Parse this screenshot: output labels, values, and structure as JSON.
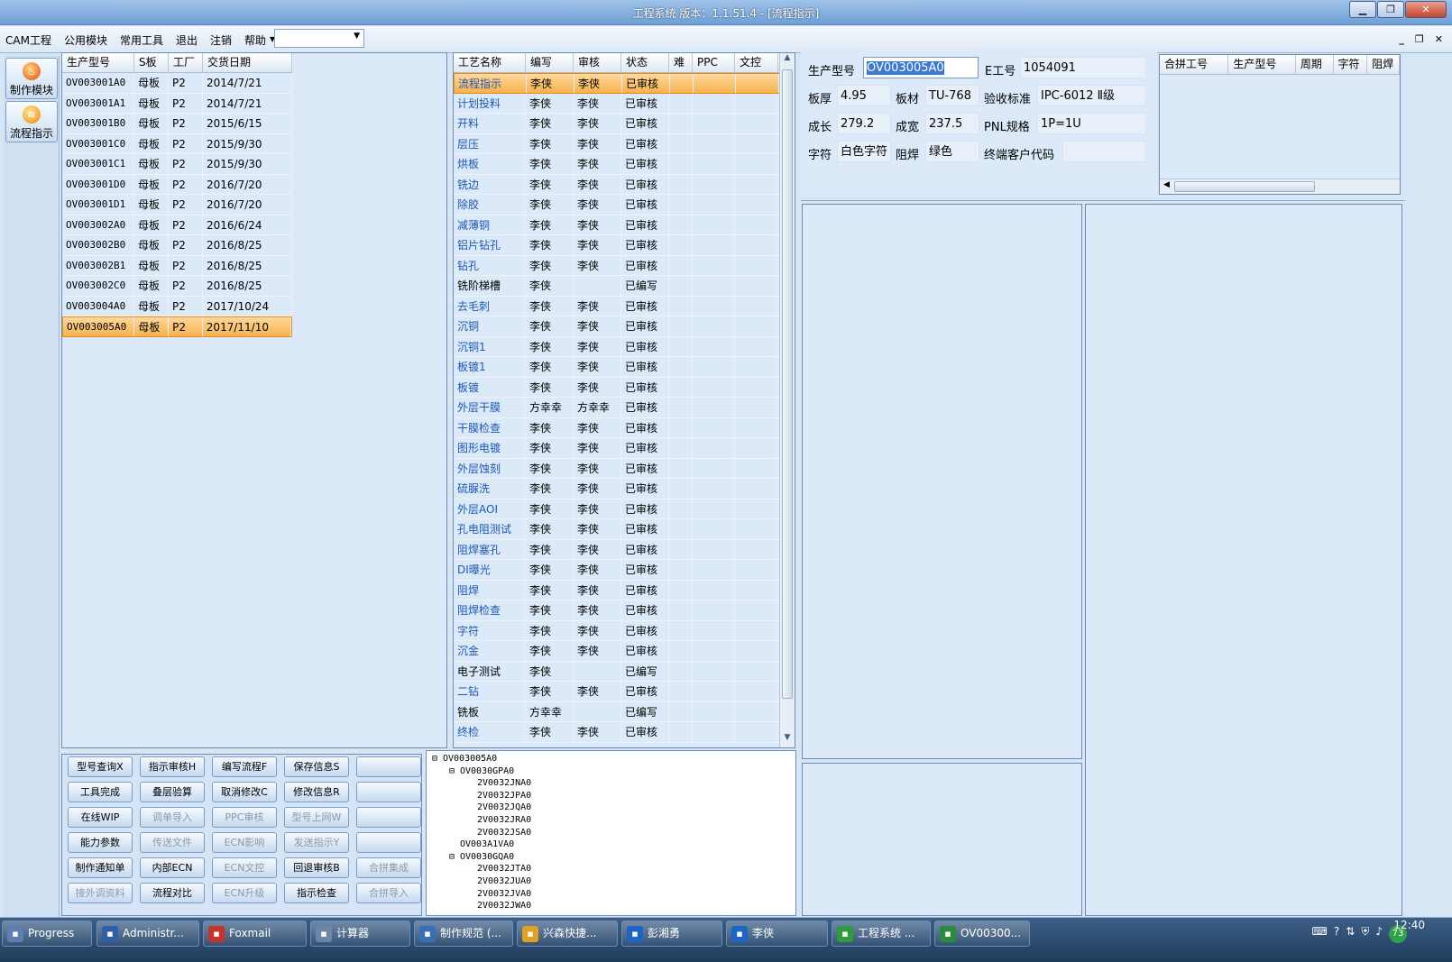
{
  "window": {
    "title": "工程系统    版本：1.1.51.4 - [流程指示]"
  },
  "menu": [
    "CAM工程",
    "公用模块",
    "常用工具",
    "退出",
    "注销",
    "帮助"
  ],
  "menu_help_arrow": "▾",
  "leftbar": [
    {
      "label": "制作模块",
      "icon": "fire-icon"
    },
    {
      "label": "流程指示",
      "icon": "flow-icon"
    }
  ],
  "products": {
    "headers": [
      "生产型号",
      "S板",
      "工厂",
      "交货日期"
    ],
    "rows": [
      [
        "OV003001A0",
        "母板",
        "P2",
        "2014/7/21"
      ],
      [
        "OV003001A1",
        "母板",
        "P2",
        "2014/7/21"
      ],
      [
        "OV003001B0",
        "母板",
        "P2",
        "2015/6/15"
      ],
      [
        "OV003001C0",
        "母板",
        "P2",
        "2015/9/30"
      ],
      [
        "OV003001C1",
        "母板",
        "P2",
        "2015/9/30"
      ],
      [
        "OV003001D0",
        "母板",
        "P2",
        "2016/7/20"
      ],
      [
        "OV003001D1",
        "母板",
        "P2",
        "2016/7/20"
      ],
      [
        "OV003002A0",
        "母板",
        "P2",
        "2016/6/24"
      ],
      [
        "OV003002B0",
        "母板",
        "P2",
        "2016/8/25"
      ],
      [
        "OV003002B1",
        "母板",
        "P2",
        "2016/8/25"
      ],
      [
        "OV003002C0",
        "母板",
        "P2",
        "2016/8/25"
      ],
      [
        "OV003004A0",
        "母板",
        "P2",
        "2017/10/24"
      ],
      [
        "OV003005A0",
        "母板",
        "P2",
        "2017/11/10"
      ]
    ],
    "selected": 12
  },
  "processes": {
    "headers": [
      "工艺名称",
      "编写",
      "审核",
      "状态",
      "难",
      "PPC",
      "文控"
    ],
    "rows": [
      [
        "流程指示",
        "李侠",
        "李侠",
        "已审核"
      ],
      [
        "计划投料",
        "李侠",
        "李侠",
        "已审核"
      ],
      [
        "开料",
        "李侠",
        "李侠",
        "已审核"
      ],
      [
        "层压",
        "李侠",
        "李侠",
        "已审核"
      ],
      [
        "烘板",
        "李侠",
        "李侠",
        "已审核"
      ],
      [
        "铣边",
        "李侠",
        "李侠",
        "已审核"
      ],
      [
        "除胶",
        "李侠",
        "李侠",
        "已审核"
      ],
      [
        "减薄铜",
        "李侠",
        "李侠",
        "已审核"
      ],
      [
        "铝片钻孔",
        "李侠",
        "李侠",
        "已审核"
      ],
      [
        "钻孔",
        "李侠",
        "李侠",
        "已审核"
      ],
      [
        "铣阶梯槽",
        "李侠",
        "",
        "已编写"
      ],
      [
        "去毛刺",
        "李侠",
        "李侠",
        "已审核"
      ],
      [
        "沉铜",
        "李侠",
        "李侠",
        "已审核"
      ],
      [
        "沉铜1",
        "李侠",
        "李侠",
        "已审核"
      ],
      [
        "板镀1",
        "李侠",
        "李侠",
        "已审核"
      ],
      [
        "板镀",
        "李侠",
        "李侠",
        "已审核"
      ],
      [
        "外层干膜",
        "方幸幸",
        "方幸幸",
        "已审核"
      ],
      [
        "干膜检查",
        "李侠",
        "李侠",
        "已审核"
      ],
      [
        "图形电镀",
        "李侠",
        "李侠",
        "已审核"
      ],
      [
        "外层蚀刻",
        "李侠",
        "李侠",
        "已审核"
      ],
      [
        "硫脲洗",
        "李侠",
        "李侠",
        "已审核"
      ],
      [
        "外层AOI",
        "李侠",
        "李侠",
        "已审核"
      ],
      [
        "孔电阻测试",
        "李侠",
        "李侠",
        "已审核"
      ],
      [
        "阻焊塞孔",
        "李侠",
        "李侠",
        "已审核"
      ],
      [
        "DI曝光",
        "李侠",
        "李侠",
        "已审核"
      ],
      [
        "阻焊",
        "李侠",
        "李侠",
        "已审核"
      ],
      [
        "阻焊检查",
        "李侠",
        "李侠",
        "已审核"
      ],
      [
        "字符",
        "李侠",
        "李侠",
        "已审核"
      ],
      [
        "沉金",
        "李侠",
        "李侠",
        "已审核"
      ],
      [
        "电子测试",
        "李侠",
        "",
        "已编写"
      ],
      [
        "二钻",
        "李侠",
        "李侠",
        "已审核"
      ],
      [
        "铣板",
        "方幸幸",
        "",
        "已编写"
      ],
      [
        "终检",
        "李侠",
        "李侠",
        "已审核"
      ]
    ],
    "selected": 0
  },
  "buttons": [
    [
      {
        "t": "型号查询X",
        "d": false
      },
      {
        "t": "指示审核H",
        "d": false
      },
      {
        "t": "编写流程F",
        "d": false
      },
      {
        "t": "保存信息S",
        "d": false
      },
      {
        "t": "",
        "d": false
      }
    ],
    [
      {
        "t": "工具完成",
        "d": false
      },
      {
        "t": "叠层验算",
        "d": false
      },
      {
        "t": "取消修改C",
        "d": false
      },
      {
        "t": "修改信息R",
        "d": false
      },
      {
        "t": "",
        "d": false
      }
    ],
    [
      {
        "t": "在线WIP",
        "d": false
      },
      {
        "t": "调单导入",
        "d": true
      },
      {
        "t": "PPC审核",
        "d": true
      },
      {
        "t": "型号上网W",
        "d": true
      },
      {
        "t": "",
        "d": false
      }
    ],
    [
      {
        "t": "能力参数",
        "d": false
      },
      {
        "t": "传送文件",
        "d": true
      },
      {
        "t": "ECN影响",
        "d": true
      },
      {
        "t": "发送指示Y",
        "d": true
      },
      {
        "t": "",
        "d": false
      }
    ],
    [
      {
        "t": "制作通知单",
        "d": false
      },
      {
        "t": "内部ECN",
        "d": false
      },
      {
        "t": "ECN文控",
        "d": true
      },
      {
        "t": "回退审核B",
        "d": false
      },
      {
        "t": "合拼集成",
        "d": true
      }
    ],
    [
      {
        "t": "接外调资料",
        "d": true
      },
      {
        "t": "流程对比",
        "d": false
      },
      {
        "t": "ECN升级",
        "d": true
      },
      {
        "t": "指示检查",
        "d": false
      },
      {
        "t": "合拼导入",
        "d": true
      }
    ]
  ],
  "tree": [
    {
      "t": "OV003005A0",
      "lv": 0
    },
    {
      "t": "OV0030GPA0",
      "lv": 1
    },
    {
      "t": "2V0032JNA0",
      "lv": 2
    },
    {
      "t": "2V0032JPA0",
      "lv": 2
    },
    {
      "t": "2V0032JQA0",
      "lv": 2
    },
    {
      "t": "2V0032JRA0",
      "lv": 2
    },
    {
      "t": "2V0032JSA0",
      "lv": 2
    },
    {
      "t": "OV003A1VA0",
      "lv": 1
    },
    {
      "t": "OV0030GQA0",
      "lv": 1
    },
    {
      "t": "2V0032JTA0",
      "lv": 2
    },
    {
      "t": "2V0032JUA0",
      "lv": 2
    },
    {
      "t": "2V0032JVA0",
      "lv": 2
    },
    {
      "t": "2V0032JWA0",
      "lv": 2
    }
  ],
  "info": {
    "model_label": "生产型号",
    "model_value": "OV003005A0",
    "e_label": "E工号",
    "e_value": "1054091",
    "thick_label": "板厚",
    "thick_value": "4.95",
    "material_label": "板材",
    "material_value": "TU-768",
    "standard_label": "验收标准",
    "standard_value": "IPC-6012 Ⅱ级",
    "len_label": "成长",
    "len_value": "279.2",
    "width_label": "成宽",
    "width_value": "237.5",
    "pnl_label": "PNL规格",
    "pnl_value": "1P=1U",
    "char_label": "字符",
    "char_value": "白色字符",
    "mask_label": "阻焊",
    "mask_value": "绿色",
    "cust_label": "终端客户代码",
    "cust_value": ""
  },
  "merge": {
    "headers": [
      "合拼工号",
      "生产型号",
      "周期",
      "字符",
      "阻焊"
    ]
  },
  "taskbar": [
    {
      "t": "Progress",
      "c": "#5b7fb0"
    },
    {
      "t": "Administr...",
      "c": "#2f5fa8"
    },
    {
      "t": "Foxmail",
      "c": "#c8342a"
    },
    {
      "t": "计算器",
      "c": "#6a87a8"
    },
    {
      "t": "制作规范 (...",
      "c": "#3a6fb8"
    },
    {
      "t": "兴森快捷...",
      "c": "#e0a020"
    },
    {
      "t": "彭湘勇",
      "c": "#1d64c4"
    },
    {
      "t": "李侠",
      "c": "#1d64c4"
    },
    {
      "t": "工程系统 ...",
      "c": "#2e9b3c"
    },
    {
      "t": "OV00300...",
      "c": "#2c8a3e"
    }
  ],
  "clock": {
    "time": "12:40",
    "badge": "73"
  }
}
